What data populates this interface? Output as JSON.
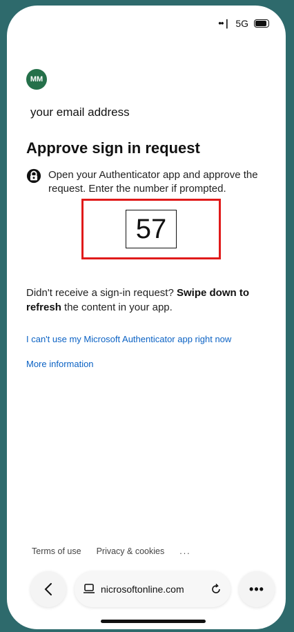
{
  "status_bar": {
    "signal": "••❘",
    "network": "5G"
  },
  "account": {
    "initials": "MM",
    "email": "your email address"
  },
  "title": "Approve sign in request",
  "instruction": "Open your Authenticator app and approve the request. Enter the number if prompted.",
  "verification_number": "57",
  "refresh_note": {
    "prefix": "Didn't receive a sign-in request? ",
    "bold1": "Swipe down to refresh",
    "suffix": " the content in your app."
  },
  "links": {
    "cant_use": "I can't use my Microsoft Authenticator app right now",
    "more_info": "More information"
  },
  "footer": {
    "terms": "Terms of use",
    "privacy": "Privacy & cookies",
    "more": "..."
  },
  "browser": {
    "url": "nicrosoftonline.com",
    "more": "•••"
  },
  "colors": {
    "avatar": "#25704a",
    "link": "#0b62c4",
    "highlight": "#e01a1a"
  }
}
